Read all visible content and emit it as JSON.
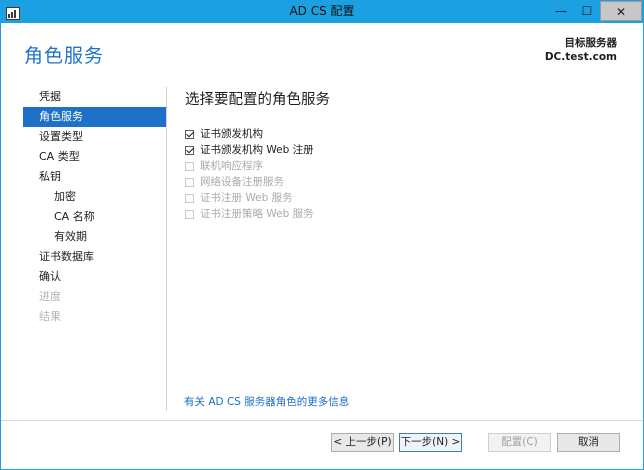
{
  "window": {
    "title": "AD CS 配置",
    "controls": {
      "minimize": "—",
      "maximize": "☐",
      "close": "✕"
    }
  },
  "header": {
    "page_title": "角色服务",
    "dest_label": "目标服务器",
    "dest_value": "DC.test.com"
  },
  "nav": {
    "items": [
      {
        "label": "凭据",
        "state": "normal"
      },
      {
        "label": "角色服务",
        "state": "active"
      },
      {
        "label": "设置类型",
        "state": "normal"
      },
      {
        "label": "CA 类型",
        "state": "normal"
      },
      {
        "label": "私钥",
        "state": "normal"
      },
      {
        "label": "加密",
        "state": "sub"
      },
      {
        "label": "CA 名称",
        "state": "sub"
      },
      {
        "label": "有效期",
        "state": "sub"
      },
      {
        "label": "证书数据库",
        "state": "normal"
      },
      {
        "label": "确认",
        "state": "normal"
      },
      {
        "label": "进度",
        "state": "disabled"
      },
      {
        "label": "结果",
        "state": "disabled"
      }
    ]
  },
  "main": {
    "section_title": "选择要配置的角色服务",
    "roles": [
      {
        "label": "证书颁发机构",
        "checked": true,
        "enabled": true
      },
      {
        "label": "证书颁发机构 Web 注册",
        "checked": true,
        "enabled": true
      },
      {
        "label": "联机响应程序",
        "checked": false,
        "enabled": false
      },
      {
        "label": "网络设备注册服务",
        "checked": false,
        "enabled": false
      },
      {
        "label": "证书注册 Web 服务",
        "checked": false,
        "enabled": false
      },
      {
        "label": "证书注册策略 Web 服务",
        "checked": false,
        "enabled": false
      }
    ],
    "more_info_link": "有关 AD CS 服务器角色的更多信息"
  },
  "footer": {
    "prev_label": "< 上一步(P)",
    "next_label": "下一步(N) >",
    "configure_label": "配置(C)",
    "cancel_label": "取消"
  },
  "colors": {
    "titlebar": "#1ba1e2",
    "accent": "#1e70c8",
    "title_text": "#1e73c8"
  }
}
